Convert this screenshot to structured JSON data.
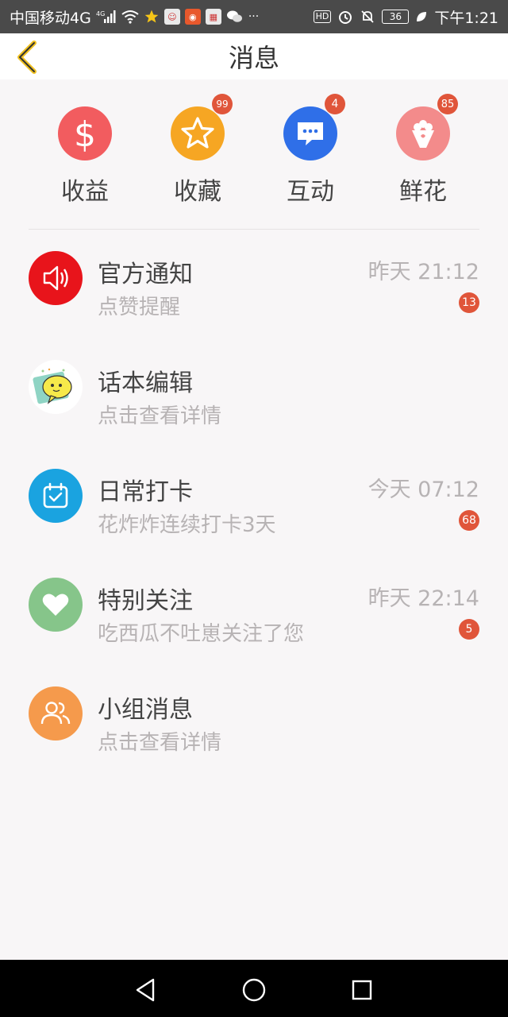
{
  "status_bar": {
    "carrier": "中国移动4G",
    "net_small": "4G",
    "battery": "36",
    "time": "下午1:21",
    "hd": "HD"
  },
  "header": {
    "title": "消息",
    "back_icon": "chevron-left-icon"
  },
  "shortcuts": [
    {
      "label": "收益",
      "icon": "dollar-icon",
      "color": "#f25c5f",
      "badge": ""
    },
    {
      "label": "收藏",
      "icon": "star-icon",
      "color": "#f6a623",
      "badge": "99"
    },
    {
      "label": "互动",
      "icon": "chat-bubble-icon",
      "color": "#2f6fe8",
      "badge": "4"
    },
    {
      "label": "鲜花",
      "icon": "flower-bouquet-icon",
      "color": "#f38b8b",
      "badge": "85"
    }
  ],
  "messages": [
    {
      "title": "官方通知",
      "subtitle": "点赞提醒",
      "time": "昨天 21:12",
      "count": "13",
      "icon": "speaker-icon",
      "color": "#e8141b"
    },
    {
      "title": "话本编辑",
      "subtitle": "点击查看详情",
      "time": "",
      "count": "",
      "icon": "editor-avatar-icon",
      "color": "#ffffff"
    },
    {
      "title": "日常打卡",
      "subtitle": "花炸炸连续打卡3天",
      "time": "今天 07:12",
      "count": "68",
      "icon": "calendar-check-icon",
      "color": "#1aa3e0"
    },
    {
      "title": "特别关注",
      "subtitle": "吃西瓜不吐崽关注了您",
      "time": "昨天 22:14",
      "count": "5",
      "icon": "heart-icon",
      "color": "#86c58a"
    },
    {
      "title": "小组消息",
      "subtitle": "点击查看详情",
      "time": "",
      "count": "",
      "icon": "group-users-icon",
      "color": "#f59a4c"
    }
  ],
  "nav_bar": {
    "back": "back-triangle-icon",
    "home": "home-circle-icon",
    "recent": "recent-square-icon"
  }
}
